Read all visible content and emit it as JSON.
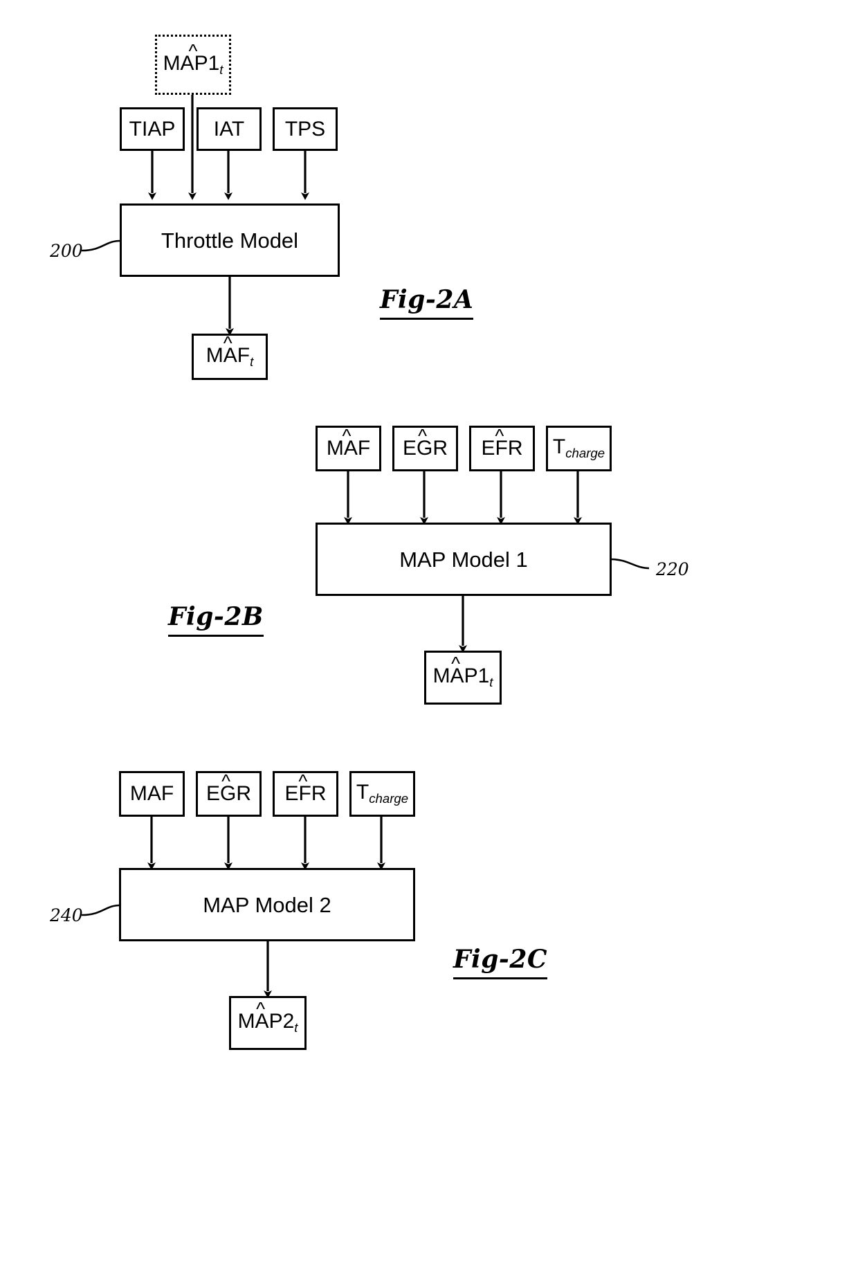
{
  "figure": {
    "type": "patent-block-diagram",
    "panels": [
      {
        "id": "fig2a",
        "label": "Fig-2A",
        "ref_numeral": "200",
        "model_label": "Throttle Model",
        "feedback_input": {
          "base": "MAP1",
          "hat": "^",
          "subscript": "t"
        },
        "inputs": [
          {
            "base": "TIAP"
          },
          {
            "base": "IAT"
          },
          {
            "base": "TPS"
          }
        ],
        "output": {
          "base": "MAF",
          "hat": "^",
          "subscript": "t"
        }
      },
      {
        "id": "fig2b",
        "label": "Fig-2B",
        "ref_numeral": "220",
        "model_label": "MAP Model 1",
        "inputs": [
          {
            "base": "MAF",
            "hat": "^"
          },
          {
            "base": "EGR",
            "hat": "^"
          },
          {
            "base": "EFR",
            "hat": "^"
          },
          {
            "base": "T",
            "subscript": "charge"
          }
        ],
        "output": {
          "base": "MAP1",
          "hat": "^",
          "subscript": "t"
        }
      },
      {
        "id": "fig2c",
        "label": "Fig-2C",
        "ref_numeral": "240",
        "model_label": "MAP Model 2",
        "inputs": [
          {
            "base": "MAF"
          },
          {
            "base": "EGR",
            "hat": "^"
          },
          {
            "base": "EFR",
            "hat": "^"
          },
          {
            "base": "T",
            "subscript": "charge"
          }
        ],
        "output": {
          "base": "MAP2",
          "hat": "^",
          "subscript": "t"
        }
      }
    ],
    "colors": {
      "stroke": "#000000",
      "background": "#ffffff"
    }
  }
}
